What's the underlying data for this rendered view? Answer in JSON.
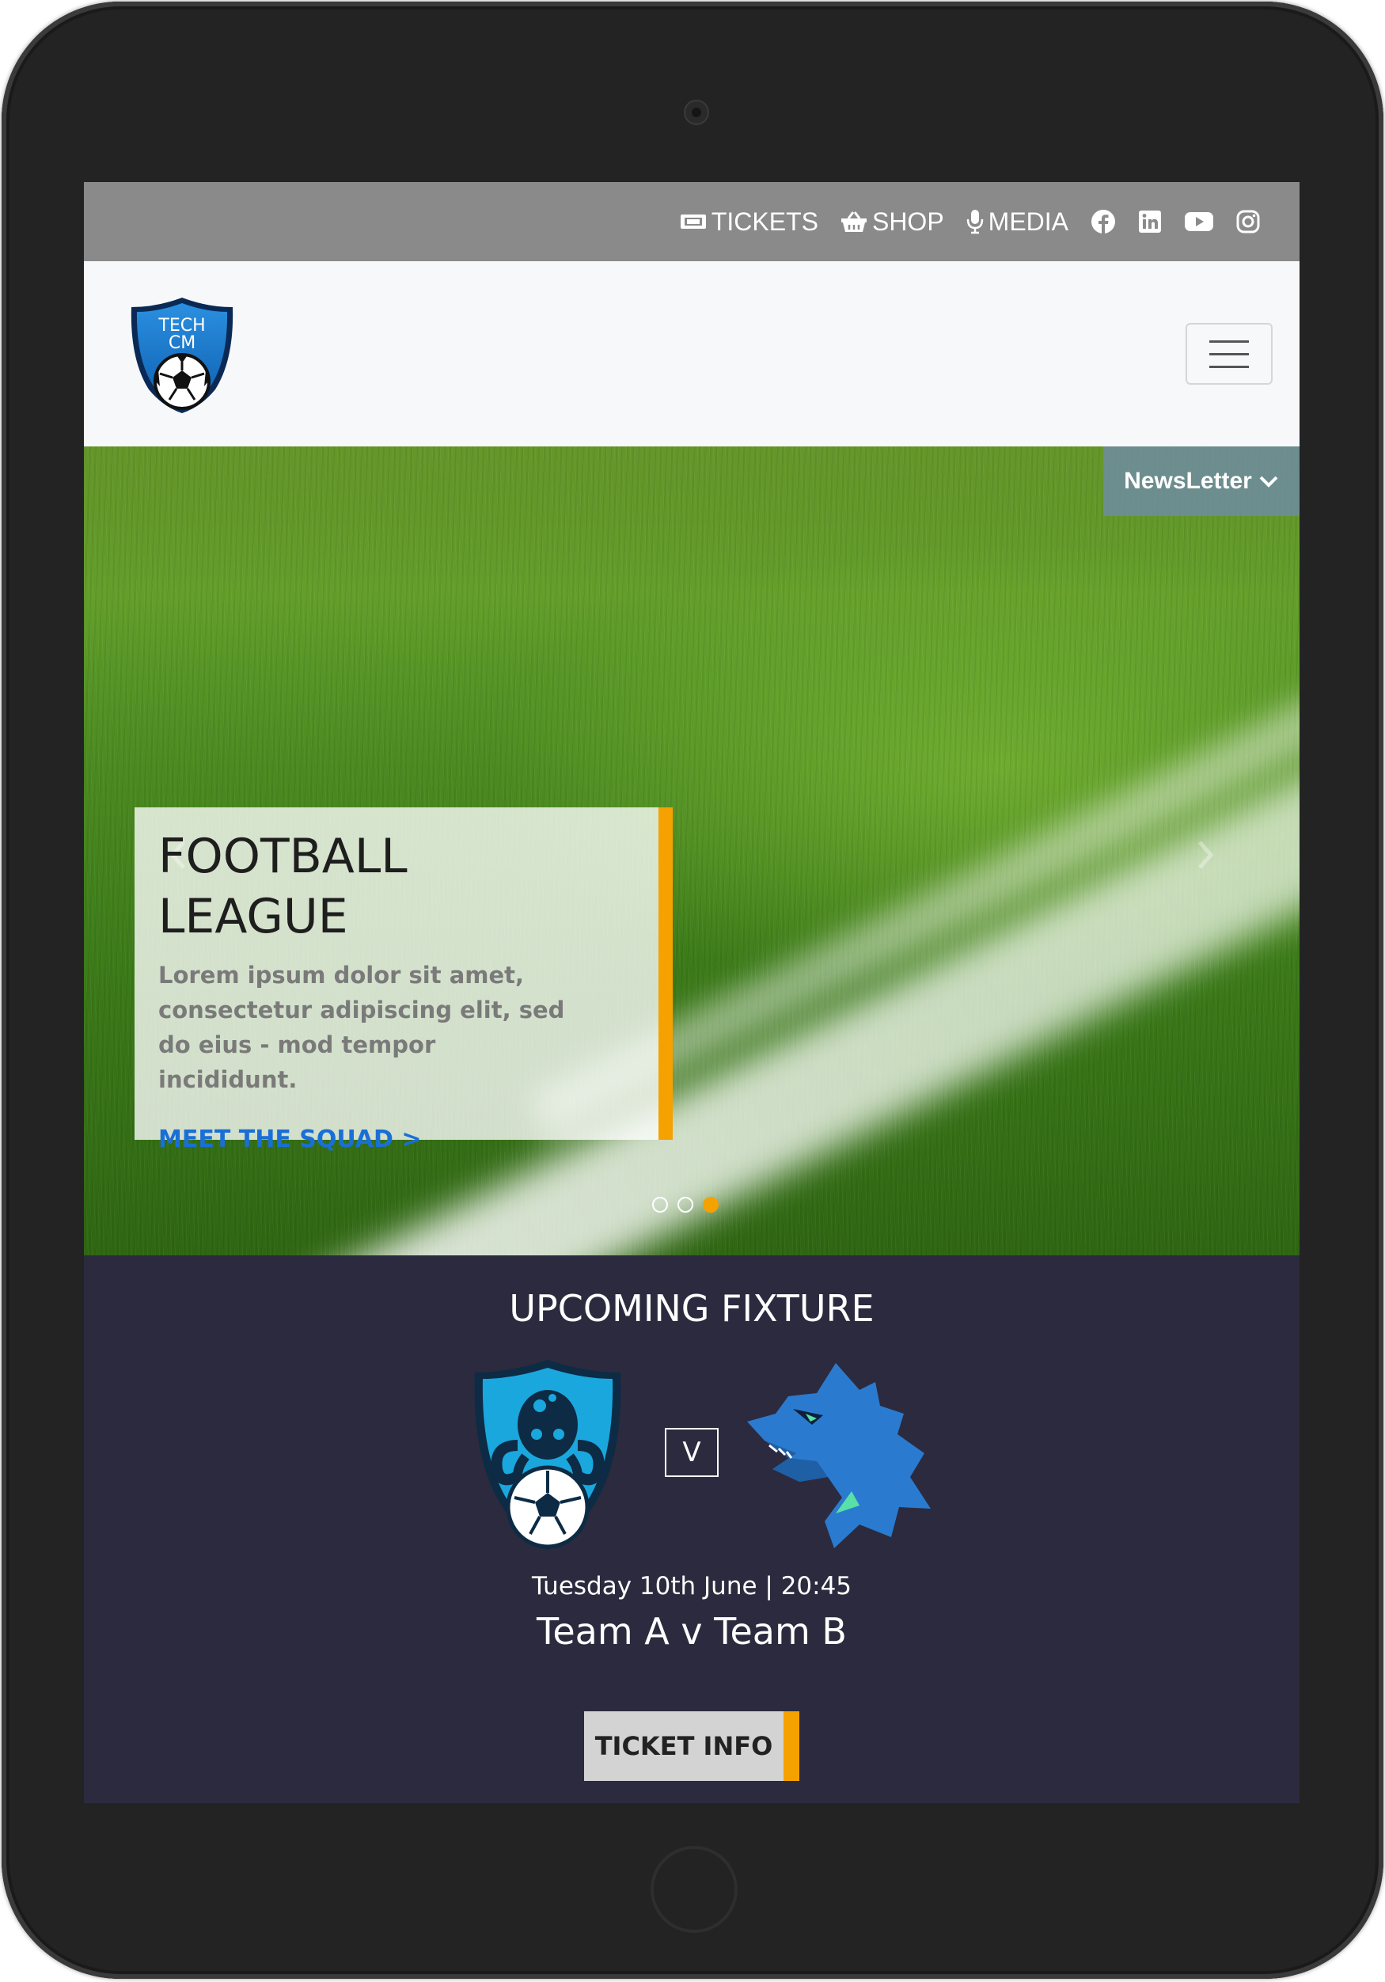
{
  "topbar": {
    "links": [
      {
        "label": "TICKETS",
        "icon": "ticket-icon"
      },
      {
        "label": "SHOP",
        "icon": "basket-icon"
      },
      {
        "label": "MEDIA",
        "icon": "microphone-icon"
      }
    ],
    "social": [
      "facebook-icon",
      "linkedin-icon",
      "youtube-icon",
      "instagram-icon"
    ]
  },
  "header": {
    "logo_text": [
      "TECH",
      "CM"
    ],
    "menu_icon": "hamburger-icon"
  },
  "hero": {
    "newsletter_label": "NewsLetter",
    "title_line1": "FOOTBALL",
    "title_line2": "LEAGUE",
    "body": "Lorem ipsum dolor sit amet, consectetur adipiscing elit, sed do eius - mod tempor incididunt.",
    "cta": "MEET THE SQUAD >",
    "slides": 3,
    "active_slide": 3
  },
  "fixture": {
    "heading": "UPCOMING FIXTURE",
    "vs_label": "V",
    "date": "Tuesday 10th June | 20:45",
    "match": "Team A v Team B",
    "button": "TICKET INFO"
  },
  "colors": {
    "accent": "#f5a200",
    "link": "#1a6fd6",
    "fixture_bg": "#2c2a3e",
    "topbar_bg": "#8a8a8a"
  }
}
